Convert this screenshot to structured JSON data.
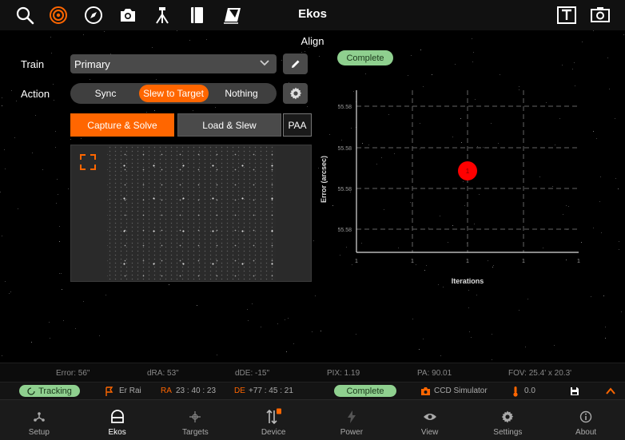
{
  "app": {
    "title": "Ekos"
  },
  "topbar": {
    "left_icons": [
      "search-icon",
      "target-icon",
      "compass-icon",
      "camera-icon",
      "tripod-icon",
      "notebook-icon",
      "flat-panel-icon"
    ],
    "right_icons": [
      "text-tool-icon",
      "screenshot-icon"
    ]
  },
  "align": {
    "section_title": "Align",
    "train_label": "Train",
    "train_value": "Primary",
    "action_label": "Action",
    "actions": [
      {
        "label": "Sync",
        "active": false
      },
      {
        "label": "Slew to Target",
        "active": true
      },
      {
        "label": "Nothing",
        "active": false
      }
    ],
    "capture_solve_label": "Capture & Solve",
    "load_slew_label": "Load & Slew",
    "paa_label": "PAA",
    "status": "Complete"
  },
  "chart_data": {
    "type": "scatter",
    "ylabel": "Error (arcsec)",
    "xlabel": "Iterations",
    "x_ticks": [
      "1",
      "1",
      "1",
      "1",
      "1"
    ],
    "y_ticks": [
      "55.58",
      "55.58",
      "55.58",
      "55.58"
    ],
    "points": [
      {
        "x": 1,
        "y": 55.58,
        "label": "1"
      }
    ],
    "grid": true,
    "point_color": "#ff0000"
  },
  "status": {
    "error": "Error: 56\"",
    "dra": "dRA: 53\"",
    "dde": "dDE: -15\"",
    "pix": "PIX: 1.19",
    "pa": "PA: 90.01",
    "fov": "FOV: 25.4' x 20.3'"
  },
  "info": {
    "tracking": "Tracking",
    "target_name": "Er Rai",
    "ra_label": "RA",
    "ra_value": "23 : 40 : 23",
    "de_label": "DE",
    "de_value": "+77 : 45 : 21",
    "align_status": "Complete",
    "camera_name": "CCD Simulator",
    "temperature": "0.0"
  },
  "nav": [
    {
      "label": "Setup",
      "icon": "setup-icon",
      "active": false
    },
    {
      "label": "Ekos",
      "icon": "ekos-icon",
      "active": true
    },
    {
      "label": "Targets",
      "icon": "targets-icon",
      "active": false
    },
    {
      "label": "Device",
      "icon": "device-icon",
      "active": false
    },
    {
      "label": "Power",
      "icon": "power-icon",
      "active": false
    },
    {
      "label": "View",
      "icon": "view-icon",
      "active": false
    },
    {
      "label": "Settings",
      "icon": "settings-icon",
      "active": false
    },
    {
      "label": "About",
      "icon": "about-icon",
      "active": false
    }
  ],
  "colors": {
    "accent": "#ff6600",
    "complete_badge": "#8fd08f",
    "ra_de_label": "#ff6600",
    "chart_point": "#ff0000"
  }
}
